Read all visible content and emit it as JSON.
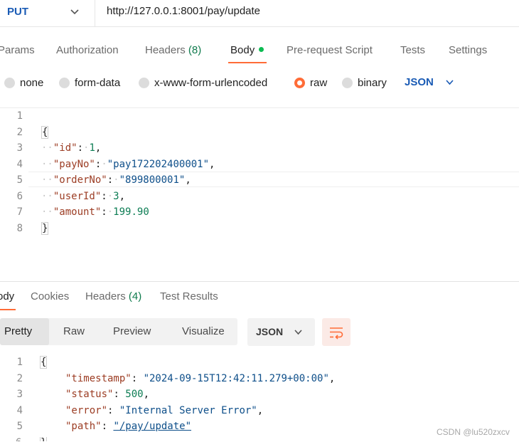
{
  "request": {
    "method": "PUT",
    "url": "http://127.0.0.1:8001/pay/update"
  },
  "request_tabs": [
    {
      "label": "Params"
    },
    {
      "label": "Authorization"
    },
    {
      "label": "Headers",
      "count": "(8)"
    },
    {
      "label": "Body"
    },
    {
      "label": "Pre-request Script"
    },
    {
      "label": "Tests"
    },
    {
      "label": "Settings"
    }
  ],
  "body_types": [
    {
      "label": "none",
      "selected": false
    },
    {
      "label": "form-data",
      "selected": false
    },
    {
      "label": "x-www-form-urlencoded",
      "selected": false
    },
    {
      "label": "raw",
      "selected": true
    },
    {
      "label": "binary",
      "selected": false
    }
  ],
  "body_format": "JSON",
  "request_body": {
    "line_numbers": [
      "1",
      "2",
      "3",
      "4",
      "5",
      "6",
      "7",
      "8"
    ],
    "fields": [
      {
        "key": "\"id\"",
        "value": "1",
        "value_type": "number"
      },
      {
        "key": "\"payNo\"",
        "value": "\"pay172202400001\"",
        "value_type": "string"
      },
      {
        "key": "\"orderNo\"",
        "value": "\"899800001\"",
        "value_type": "string"
      },
      {
        "key": "\"userId\"",
        "value": "3",
        "value_type": "number"
      },
      {
        "key": "\"amount\"",
        "value": "199.90",
        "value_type": "number"
      }
    ]
  },
  "response_tabs": [
    {
      "label": "ody"
    },
    {
      "label": "Cookies"
    },
    {
      "label": "Headers",
      "count": "(4)"
    },
    {
      "label": "Test Results"
    }
  ],
  "view_modes": [
    "Pretty",
    "Raw",
    "Preview",
    "Visualize"
  ],
  "response_format": "JSON",
  "response_body": {
    "line_numbers": [
      "1",
      "2",
      "3",
      "4",
      "5"
    ],
    "fields": [
      {
        "key": "\"timestamp\"",
        "value": "\"2024-09-15T12:42:11.279+00:00\"",
        "value_type": "string"
      },
      {
        "key": "\"status\"",
        "value": "500",
        "value_type": "number"
      },
      {
        "key": "\"error\"",
        "value": "\"Internal Server Error\"",
        "value_type": "string"
      },
      {
        "key": "\"path\"",
        "value": "\"/pay/update\"",
        "value_type": "string"
      }
    ]
  },
  "watermark": "CSDN @lu520zxcv",
  "colors": {
    "accent_orange": "#ff6c37",
    "method_blue": "#1a5bb5",
    "count_green": "#0f7b4d",
    "dot_green": "#0cbb52"
  }
}
